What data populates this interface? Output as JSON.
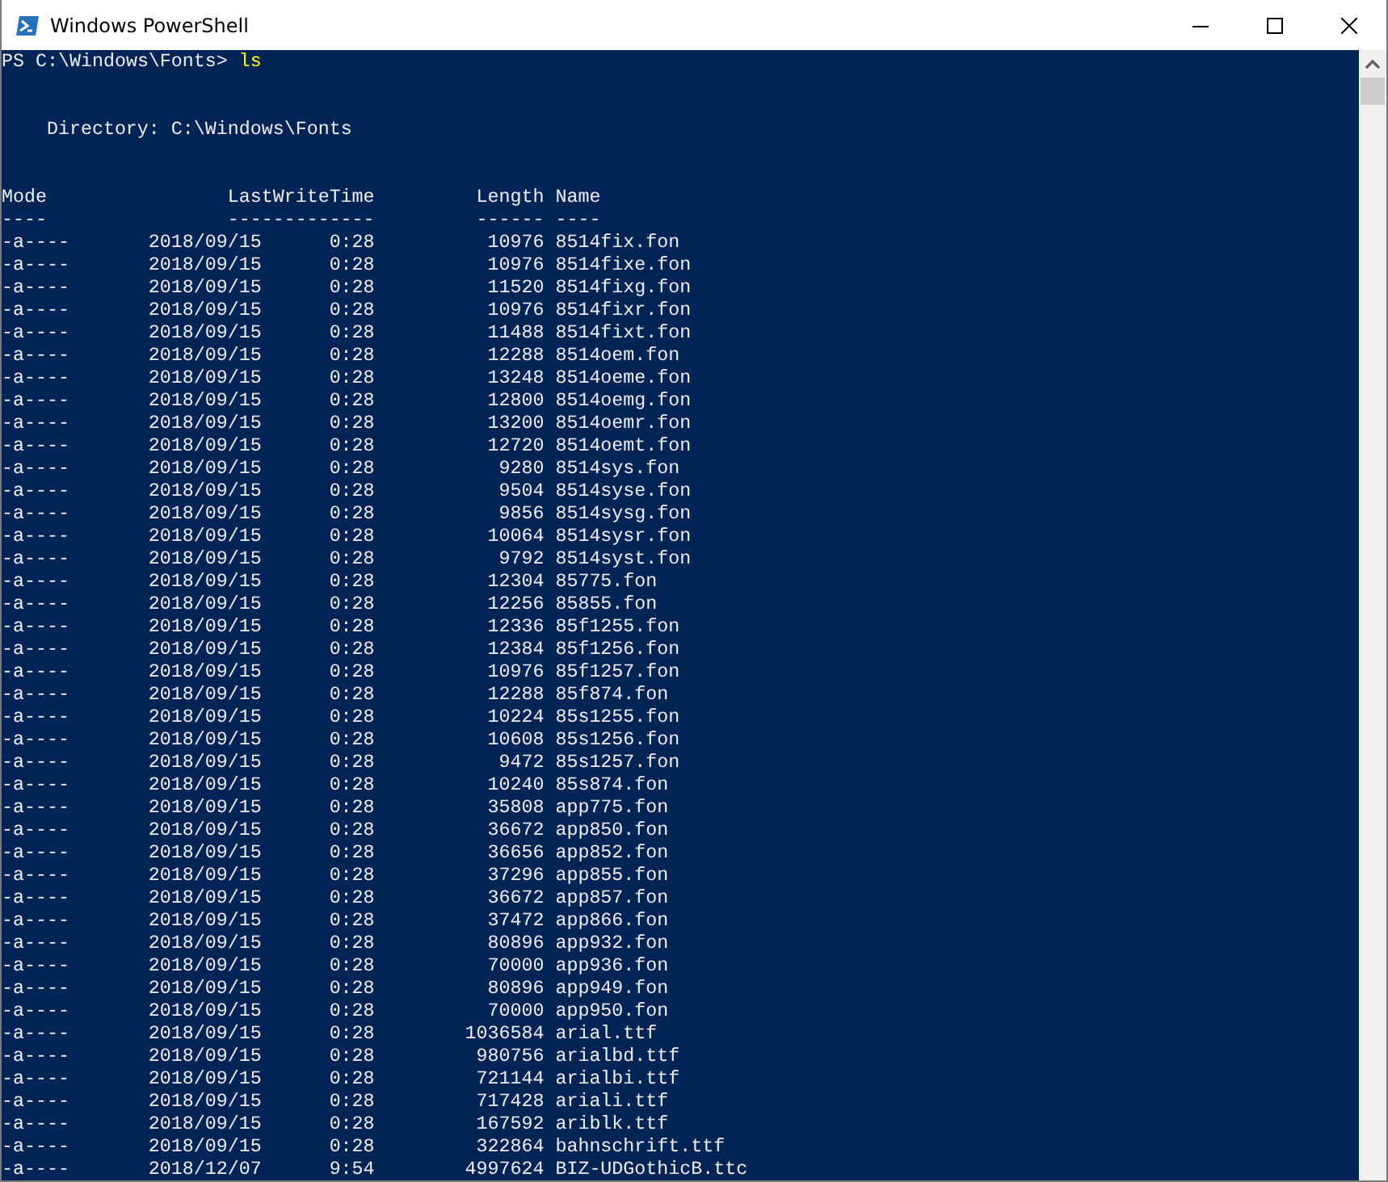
{
  "window": {
    "title": "Windows PowerShell"
  },
  "prompt": {
    "text": "PS C:\\Windows\\Fonts>",
    "command": "ls"
  },
  "directory": "Directory: C:\\Windows\\Fonts",
  "columns": [
    {
      "label": "Mode",
      "underline": "----"
    },
    {
      "label": "LastWriteTime",
      "underline": "-------------"
    },
    {
      "label": "Length",
      "underline": "------"
    },
    {
      "label": "Name",
      "underline": "----"
    }
  ],
  "rows": [
    {
      "mode": "-a----",
      "date": "2018/09/15",
      "time": "0:28",
      "length": "10976",
      "name": "8514fix.fon"
    },
    {
      "mode": "-a----",
      "date": "2018/09/15",
      "time": "0:28",
      "length": "10976",
      "name": "8514fixe.fon"
    },
    {
      "mode": "-a----",
      "date": "2018/09/15",
      "time": "0:28",
      "length": "11520",
      "name": "8514fixg.fon"
    },
    {
      "mode": "-a----",
      "date": "2018/09/15",
      "time": "0:28",
      "length": "10976",
      "name": "8514fixr.fon"
    },
    {
      "mode": "-a----",
      "date": "2018/09/15",
      "time": "0:28",
      "length": "11488",
      "name": "8514fixt.fon"
    },
    {
      "mode": "-a----",
      "date": "2018/09/15",
      "time": "0:28",
      "length": "12288",
      "name": "8514oem.fon"
    },
    {
      "mode": "-a----",
      "date": "2018/09/15",
      "time": "0:28",
      "length": "13248",
      "name": "8514oeme.fon"
    },
    {
      "mode": "-a----",
      "date": "2018/09/15",
      "time": "0:28",
      "length": "12800",
      "name": "8514oemg.fon"
    },
    {
      "mode": "-a----",
      "date": "2018/09/15",
      "time": "0:28",
      "length": "13200",
      "name": "8514oemr.fon"
    },
    {
      "mode": "-a----",
      "date": "2018/09/15",
      "time": "0:28",
      "length": "12720",
      "name": "8514oemt.fon"
    },
    {
      "mode": "-a----",
      "date": "2018/09/15",
      "time": "0:28",
      "length": "9280",
      "name": "8514sys.fon"
    },
    {
      "mode": "-a----",
      "date": "2018/09/15",
      "time": "0:28",
      "length": "9504",
      "name": "8514syse.fon"
    },
    {
      "mode": "-a----",
      "date": "2018/09/15",
      "time": "0:28",
      "length": "9856",
      "name": "8514sysg.fon"
    },
    {
      "mode": "-a----",
      "date": "2018/09/15",
      "time": "0:28",
      "length": "10064",
      "name": "8514sysr.fon"
    },
    {
      "mode": "-a----",
      "date": "2018/09/15",
      "time": "0:28",
      "length": "9792",
      "name": "8514syst.fon"
    },
    {
      "mode": "-a----",
      "date": "2018/09/15",
      "time": "0:28",
      "length": "12304",
      "name": "85775.fon"
    },
    {
      "mode": "-a----",
      "date": "2018/09/15",
      "time": "0:28",
      "length": "12256",
      "name": "85855.fon"
    },
    {
      "mode": "-a----",
      "date": "2018/09/15",
      "time": "0:28",
      "length": "12336",
      "name": "85f1255.fon"
    },
    {
      "mode": "-a----",
      "date": "2018/09/15",
      "time": "0:28",
      "length": "12384",
      "name": "85f1256.fon"
    },
    {
      "mode": "-a----",
      "date": "2018/09/15",
      "time": "0:28",
      "length": "10976",
      "name": "85f1257.fon"
    },
    {
      "mode": "-a----",
      "date": "2018/09/15",
      "time": "0:28",
      "length": "12288",
      "name": "85f874.fon"
    },
    {
      "mode": "-a----",
      "date": "2018/09/15",
      "time": "0:28",
      "length": "10224",
      "name": "85s1255.fon"
    },
    {
      "mode": "-a----",
      "date": "2018/09/15",
      "time": "0:28",
      "length": "10608",
      "name": "85s1256.fon"
    },
    {
      "mode": "-a----",
      "date": "2018/09/15",
      "time": "0:28",
      "length": "9472",
      "name": "85s1257.fon"
    },
    {
      "mode": "-a----",
      "date": "2018/09/15",
      "time": "0:28",
      "length": "10240",
      "name": "85s874.fon"
    },
    {
      "mode": "-a----",
      "date": "2018/09/15",
      "time": "0:28",
      "length": "35808",
      "name": "app775.fon"
    },
    {
      "mode": "-a----",
      "date": "2018/09/15",
      "time": "0:28",
      "length": "36672",
      "name": "app850.fon"
    },
    {
      "mode": "-a----",
      "date": "2018/09/15",
      "time": "0:28",
      "length": "36656",
      "name": "app852.fon"
    },
    {
      "mode": "-a----",
      "date": "2018/09/15",
      "time": "0:28",
      "length": "37296",
      "name": "app855.fon"
    },
    {
      "mode": "-a----",
      "date": "2018/09/15",
      "time": "0:28",
      "length": "36672",
      "name": "app857.fon"
    },
    {
      "mode": "-a----",
      "date": "2018/09/15",
      "time": "0:28",
      "length": "37472",
      "name": "app866.fon"
    },
    {
      "mode": "-a----",
      "date": "2018/09/15",
      "time": "0:28",
      "length": "80896",
      "name": "app932.fon"
    },
    {
      "mode": "-a----",
      "date": "2018/09/15",
      "time": "0:28",
      "length": "70000",
      "name": "app936.fon"
    },
    {
      "mode": "-a----",
      "date": "2018/09/15",
      "time": "0:28",
      "length": "80896",
      "name": "app949.fon"
    },
    {
      "mode": "-a----",
      "date": "2018/09/15",
      "time": "0:28",
      "length": "70000",
      "name": "app950.fon"
    },
    {
      "mode": "-a----",
      "date": "2018/09/15",
      "time": "0:28",
      "length": "1036584",
      "name": "arial.ttf"
    },
    {
      "mode": "-a----",
      "date": "2018/09/15",
      "time": "0:28",
      "length": "980756",
      "name": "arialbd.ttf"
    },
    {
      "mode": "-a----",
      "date": "2018/09/15",
      "time": "0:28",
      "length": "721144",
      "name": "arialbi.ttf"
    },
    {
      "mode": "-a----",
      "date": "2018/09/15",
      "time": "0:28",
      "length": "717428",
      "name": "ariali.ttf"
    },
    {
      "mode": "-a----",
      "date": "2018/09/15",
      "time": "0:28",
      "length": "167592",
      "name": "ariblk.ttf"
    },
    {
      "mode": "-a----",
      "date": "2018/09/15",
      "time": "0:28",
      "length": "322864",
      "name": "bahnschrift.ttf"
    },
    {
      "mode": "-a----",
      "date": "2018/12/07",
      "time": "9:54",
      "length": "4997624",
      "name": "BIZ-UDGothicB.ttc"
    }
  ]
}
